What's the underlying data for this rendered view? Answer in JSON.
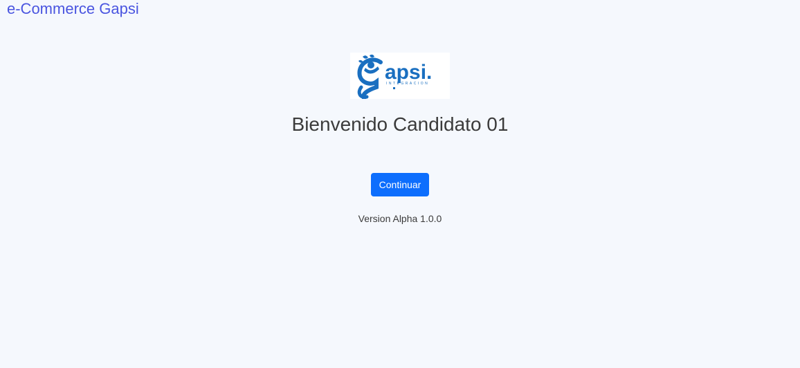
{
  "header": {
    "brand_label": "e-Commerce Gapsi"
  },
  "logo": {
    "wordmark": "apsi.",
    "subtitle": "INTEGRACION",
    "color": "#1a6fc0"
  },
  "main": {
    "welcome_text": "Bienvenido Candidato 01",
    "continue_label": "Continuar",
    "version_text": "Version Alpha 1.0.0"
  },
  "colors": {
    "brand_link": "#4a55e0",
    "primary_button": "#0d6efd",
    "background": "#f5f8fd"
  }
}
